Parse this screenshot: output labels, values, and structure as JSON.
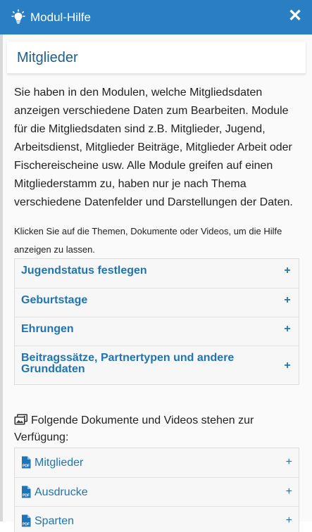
{
  "header": {
    "title": "Modul-Hilfe",
    "icon": "lightbulb-icon",
    "close_icon": "close-icon",
    "color": "#2a7fc4"
  },
  "page": {
    "title": "Mitglieder",
    "intro": "Sie haben in den Modulen, welche Mitgliedsdaten anzeigen verschiedene Daten zum Bearbeiten. Module für die Mitgliedsdaten sind z.B. Mitglieder, Jugend, Arbeitsdienst, Mitglieder Beiträge, Mitglieder Arbeit oder Fischereischeine usw. Alle Module greifen auf einen Mitgliederstamm zu, haben nur je nach Thema verschiedene Datenfelder und Darstellungen der Daten.",
    "hint": "Klicken Sie auf die Themen, Dokumente oder Videos, um die Hilfe anzeigen zu lassen."
  },
  "topics": [
    {
      "label": "Jugendstatus festlegen",
      "toggle": "+"
    },
    {
      "label": "Geburtstage",
      "toggle": "+"
    },
    {
      "label": "Ehrungen",
      "toggle": "+"
    },
    {
      "label": "Beitragssätze, Partnertypen und andere Grunddaten",
      "toggle": "+"
    }
  ],
  "documents": {
    "heading": "Folgende Dokumente und Videos stehen zur Verfügung:",
    "heading_icon": "images-icon",
    "items": [
      {
        "label": "Mitglieder",
        "icon": "pdf-icon",
        "toggle": "+"
      },
      {
        "label": "Ausdrucke",
        "icon": "pdf-icon",
        "toggle": "+"
      },
      {
        "label": "Sparten",
        "icon": "pdf-icon",
        "toggle": "+"
      }
    ]
  },
  "colors": {
    "link": "#1f74b6",
    "title": "#1d5d8f"
  }
}
